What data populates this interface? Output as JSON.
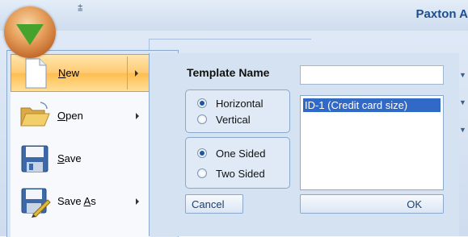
{
  "window": {
    "app_title": "Paxton A",
    "qat_arrow": "⩲"
  },
  "app_menu": {
    "items": [
      {
        "prefix": "",
        "mnemonic": "N",
        "suffix": "ew",
        "icon": "new-document-icon",
        "has_submenu": true,
        "active": true
      },
      {
        "prefix": "",
        "mnemonic": "O",
        "suffix": "pen",
        "icon": "open-folder-icon",
        "has_submenu": true,
        "active": false
      },
      {
        "prefix": "",
        "mnemonic": "S",
        "suffix": "ave",
        "icon": "save-disk-icon",
        "has_submenu": false,
        "active": false
      },
      {
        "prefix": "Save ",
        "mnemonic": "A",
        "suffix": "s",
        "icon": "save-as-icon",
        "has_submenu": true,
        "active": false
      }
    ]
  },
  "new_panel": {
    "template_name_label": "Template Name",
    "template_name_value": "",
    "orientation": {
      "options": [
        "Horizontal",
        "Vertical"
      ],
      "selected": "Horizontal"
    },
    "sides": {
      "options": [
        "One Sided",
        "Two Sided"
      ],
      "selected": "One Sided"
    },
    "sizes": [
      "ID-1 (Credit card size)"
    ],
    "selected_size": "ID-1 (Credit card size)",
    "cancel_label": "Cancel",
    "ok_label": "OK"
  },
  "colors": {
    "selection": "#3169c6",
    "active_menu": "#ffca74",
    "orb_arrow": "#45a32d"
  }
}
